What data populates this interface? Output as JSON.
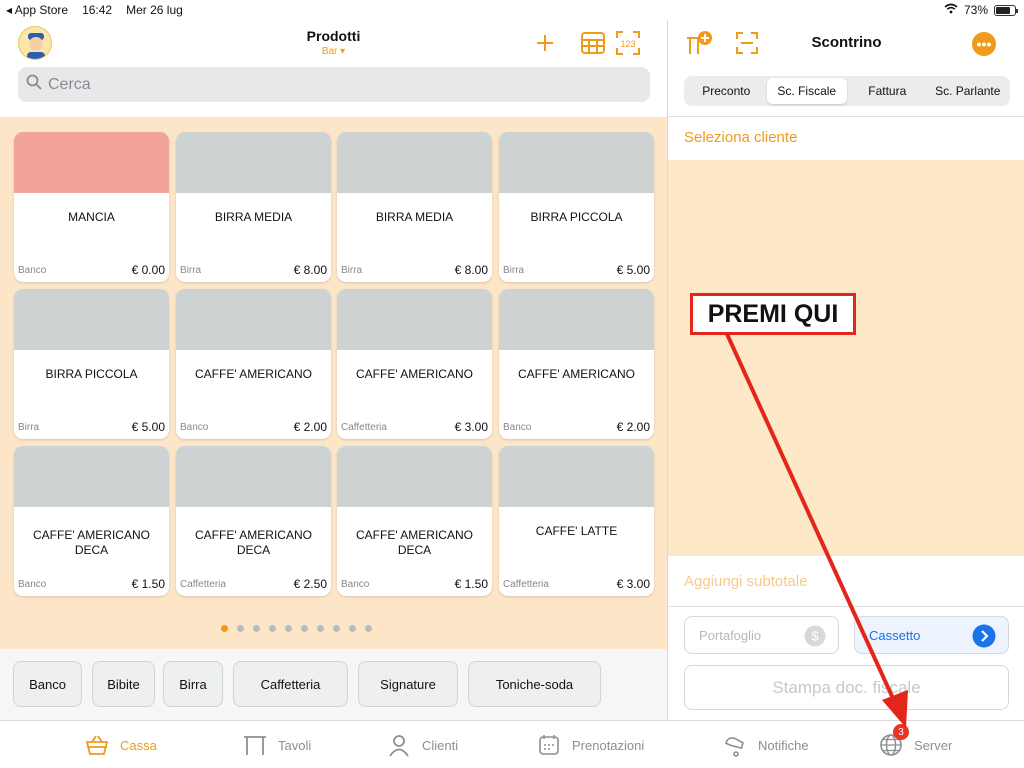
{
  "status_bar": {
    "carrier": "◂ App Store",
    "time": "16:42",
    "date": "Mer 26 lug",
    "battery": "73%"
  },
  "products_header": {
    "title": "Prodotti",
    "subtitle": "Bar ▾"
  },
  "search": {
    "placeholder": "Cerca"
  },
  "products": [
    {
      "name": "MANCIA",
      "category": "Banco",
      "price": "€ 0.00"
    },
    {
      "name": "BIRRA MEDIA",
      "category": "Birra",
      "price": "€ 8.00"
    },
    {
      "name": "BIRRA MEDIA",
      "category": "Birra",
      "price": "€ 8.00"
    },
    {
      "name": "BIRRA PICCOLA",
      "category": "Birra",
      "price": "€ 5.00"
    },
    {
      "name": "BIRRA PICCOLA",
      "category": "Birra",
      "price": "€ 5.00"
    },
    {
      "name": "CAFFE' AMERICANO",
      "category": "Banco",
      "price": "€ 2.00"
    },
    {
      "name": "CAFFE' AMERICANO",
      "category": "Caffetteria",
      "price": "€ 3.00"
    },
    {
      "name": "CAFFE' AMERICANO",
      "category": "Banco",
      "price": "€ 2.00"
    },
    {
      "name": "CAFFE' AMERICANO DECA",
      "category": "Banco",
      "price": "€ 1.50"
    },
    {
      "name": "CAFFE' AMERICANO DECA",
      "category": "Caffetteria",
      "price": "€ 2.50"
    },
    {
      "name": "CAFFE' AMERICANO DECA",
      "category": "Banco",
      "price": "€ 1.50"
    },
    {
      "name": "CAFFE' LATTE",
      "category": "Caffetteria",
      "price": "€ 3.00"
    }
  ],
  "pagination": {
    "pages": 10,
    "current": 1
  },
  "categories": [
    "Banco",
    "Bibite",
    "Birra",
    "Caffetteria",
    "Signature",
    "Toniche-soda"
  ],
  "receipt": {
    "title": "Scontrino",
    "segments": [
      "Preconto",
      "Sc. Fiscale",
      "Fattura",
      "Sc. Parlante"
    ],
    "active_segment": "Sc. Fiscale",
    "select_client": "Seleziona cliente",
    "add_subtotal": "Aggiungi subtotale",
    "wallet": "Portafoglio",
    "drawer": "Cassetto",
    "print": "Stampa doc. fiscale"
  },
  "tabs": [
    {
      "label": "Cassa",
      "icon": "basket-icon",
      "active": true
    },
    {
      "label": "Tavoli",
      "icon": "table-icon",
      "active": false
    },
    {
      "label": "Clienti",
      "icon": "person-icon",
      "active": false
    },
    {
      "label": "Prenotazioni",
      "icon": "calendar-icon",
      "active": false
    },
    {
      "label": "Notifiche",
      "icon": "bell-icon",
      "active": false
    },
    {
      "label": "Server",
      "icon": "globe-icon",
      "active": false
    }
  ],
  "server_badge": "3",
  "annotation": {
    "label": "PREMI QUI"
  },
  "colors": {
    "accent": "#f09a1a",
    "grid_bg": "#fde6c7",
    "receipt_bg": "#fde8c8",
    "annotation": "#e2261c",
    "drawer_blue": "#1a73e8"
  }
}
